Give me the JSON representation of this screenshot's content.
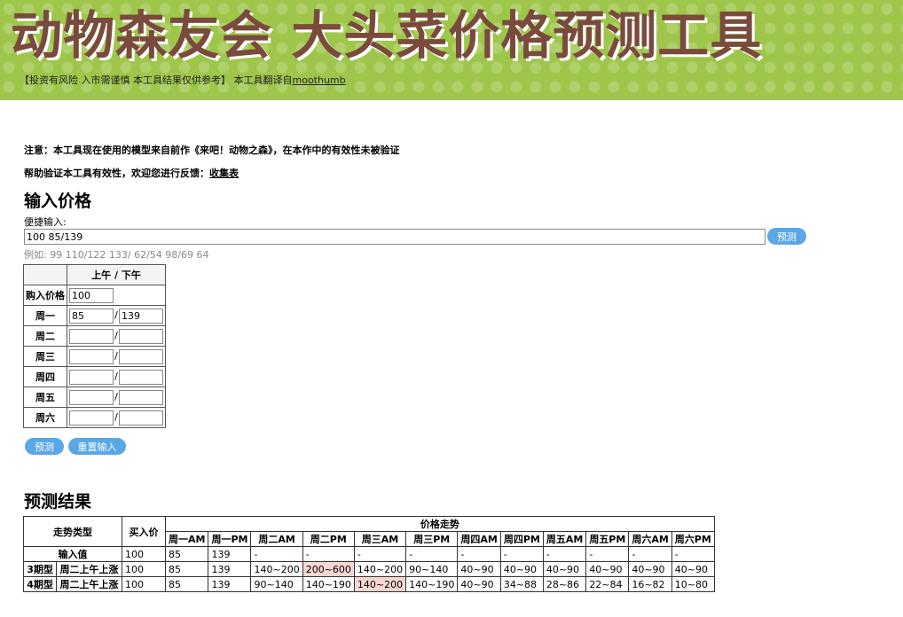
{
  "header": {
    "title": "动物森友会 大头菜价格预测工具",
    "disclaimer": "【投资有风险 入市需谨慎 本工具结果仅供参考】 本工具翻译自",
    "credit_link": "moothumb"
  },
  "notes": {
    "line1": "注意：本工具现在使用的模型来自前作《来吧！动物之森》，在本作中的有效性未被验证",
    "line2_prefix": "帮助验证本工具有效性，欢迎您进行反馈：",
    "feedback_link": "收集表"
  },
  "input_section": {
    "heading": "输入价格",
    "quick_label": "便捷输入:",
    "quick_value": "100 85/139",
    "predict_button": "预测",
    "example": "例如: 99 110/122 133/ 62/54 98/69 64",
    "table_header": "上午 / 下午",
    "buy_label": "购入价格",
    "buy_value": "100",
    "separator": "/",
    "days": [
      {
        "label": "周一",
        "am": "85",
        "pm": "139"
      },
      {
        "label": "周二",
        "am": "",
        "pm": ""
      },
      {
        "label": "周三",
        "am": "",
        "pm": ""
      },
      {
        "label": "周四",
        "am": "",
        "pm": ""
      },
      {
        "label": "周五",
        "am": "",
        "pm": ""
      },
      {
        "label": "周六",
        "am": "",
        "pm": ""
      }
    ],
    "predict_button2": "预测",
    "reset_button": "重置输入"
  },
  "results": {
    "heading": "预测结果",
    "col_type": "走势类型",
    "col_buy": "买入价",
    "col_trend": "价格走势",
    "periods": [
      "周一AM",
      "周一PM",
      "周二AM",
      "周二PM",
      "周三AM",
      "周三PM",
      "周四AM",
      "周四PM",
      "周五AM",
      "周五PM",
      "周六AM",
      "周六PM"
    ],
    "rows": [
      {
        "label": "输入值",
        "buy": "100",
        "values": [
          "85",
          "139",
          "-",
          "-",
          "-",
          "-",
          "-",
          "-",
          "-",
          "-",
          "-",
          "-"
        ],
        "highlight": -1
      },
      {
        "label": "3期型",
        "sub": "周二上午上涨",
        "buy": "100",
        "values": [
          "85",
          "139",
          "140~200",
          "200~600",
          "140~200",
          "90~140",
          "40~90",
          "40~90",
          "40~90",
          "40~90",
          "40~90",
          "40~90"
        ],
        "highlight": 3
      },
      {
        "label": "4期型",
        "sub": "周二上午上涨",
        "buy": "100",
        "values": [
          "85",
          "139",
          "90~140",
          "140~190",
          "140~200",
          "140~190",
          "40~90",
          "34~88",
          "28~86",
          "22~84",
          "16~82",
          "10~80"
        ],
        "highlight": 4
      }
    ]
  }
}
